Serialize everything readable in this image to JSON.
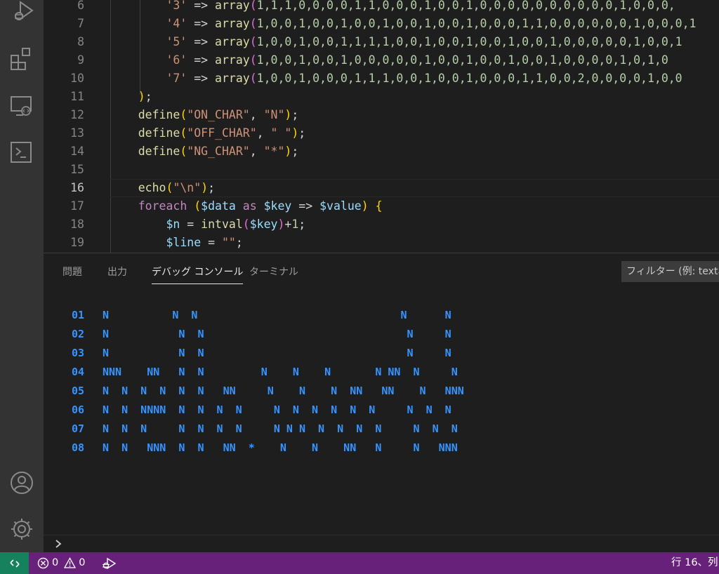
{
  "editor": {
    "current_line": 16,
    "lines": [
      {
        "n": "6",
        "indent": 2,
        "key": "'3'",
        "arr": "1,1,1,0,0,0,0,1,1,0,0,0,1,0,0,1,0,0,0,0,0,0,0,0,0,0,1,0,0,0,"
      },
      {
        "n": "7",
        "indent": 2,
        "key": "'4'",
        "arr": "1,0,0,1,0,0,1,0,0,1,0,0,1,0,0,1,0,0,0,1,1,0,0,0,0,0,0,1,0,0,0,1"
      },
      {
        "n": "8",
        "indent": 2,
        "key": "'5'",
        "arr": "1,0,0,1,0,0,1,1,1,1,0,0,1,0,0,1,0,0,1,0,0,1,0,0,0,0,0,1,0,0,1"
      },
      {
        "n": "9",
        "indent": 2,
        "key": "'6'",
        "arr": "1,0,0,1,0,0,1,0,0,0,0,0,1,0,0,1,0,0,1,0,0,1,0,0,0,0,1,0,1,0"
      },
      {
        "n": "10",
        "indent": 2,
        "key": "'7'",
        "arr": "1,0,0,1,0,0,0,1,1,1,0,0,1,0,0,1,0,0,0,1,1,0,0,2,0,0,0,0,1,0,0"
      }
    ],
    "close_line": {
      "n": "11",
      "text": ");"
    },
    "defines": [
      {
        "n": "12",
        "fn": "define",
        "name": "\"ON_CHAR\"",
        "value": "\"N\""
      },
      {
        "n": "13",
        "fn": "define",
        "name": "\"OFF_CHAR\"",
        "value": "\" \""
      },
      {
        "n": "14",
        "fn": "define",
        "name": "\"NG_CHAR\"",
        "value": "\"*\""
      }
    ],
    "blank_line": {
      "n": "15"
    },
    "echo_line": {
      "n": "16",
      "fn": "echo",
      "arg": "\"\\n\""
    },
    "foreach_line": {
      "n": "17",
      "kw": "foreach",
      "v1": "$data",
      "as": "as",
      "v2": "$key",
      "v3": "$value"
    },
    "n_line": {
      "n": "18",
      "v": "$n",
      "fn": "intval",
      "arg": "$key",
      "tail": "+1;"
    },
    "line_line": {
      "n": "19",
      "v": "$line",
      "tail": "\"\";"
    }
  },
  "panel": {
    "tabs": [
      "問題",
      "出力",
      "デバッグ コンソール",
      "ターミナル"
    ],
    "active_tab": "デバッグ コンソール",
    "filter_placeholder": "フィルター (例: text、",
    "output": [
      {
        "num": "01",
        "text": "N          N  N                                N      N"
      },
      {
        "num": "02",
        "text": "N           N  N                                N     N"
      },
      {
        "num": "03",
        "text": "N           N  N                                N     N"
      },
      {
        "num": "04",
        "text": "NNN    NN   N  N         N    N    N       N NN  N     N"
      },
      {
        "num": "05",
        "text": "N  N  N  N  N  N   NN     N    N    N  NN   NN    N   NNN"
      },
      {
        "num": "06",
        "text": "N  N  NNNN  N  N  N  N     N  N  N  N  N  N     N  N  N"
      },
      {
        "num": "07",
        "text": "N  N  N     N  N  N  N     N N N  N  N  N  N     N  N  N"
      },
      {
        "num": "08",
        "text": "N  N   NNN  N  N   NN  *    N    N    NN   N     N   NNN"
      }
    ]
  },
  "status": {
    "errors": "0",
    "warnings": "0",
    "position": "行 16、列"
  }
}
